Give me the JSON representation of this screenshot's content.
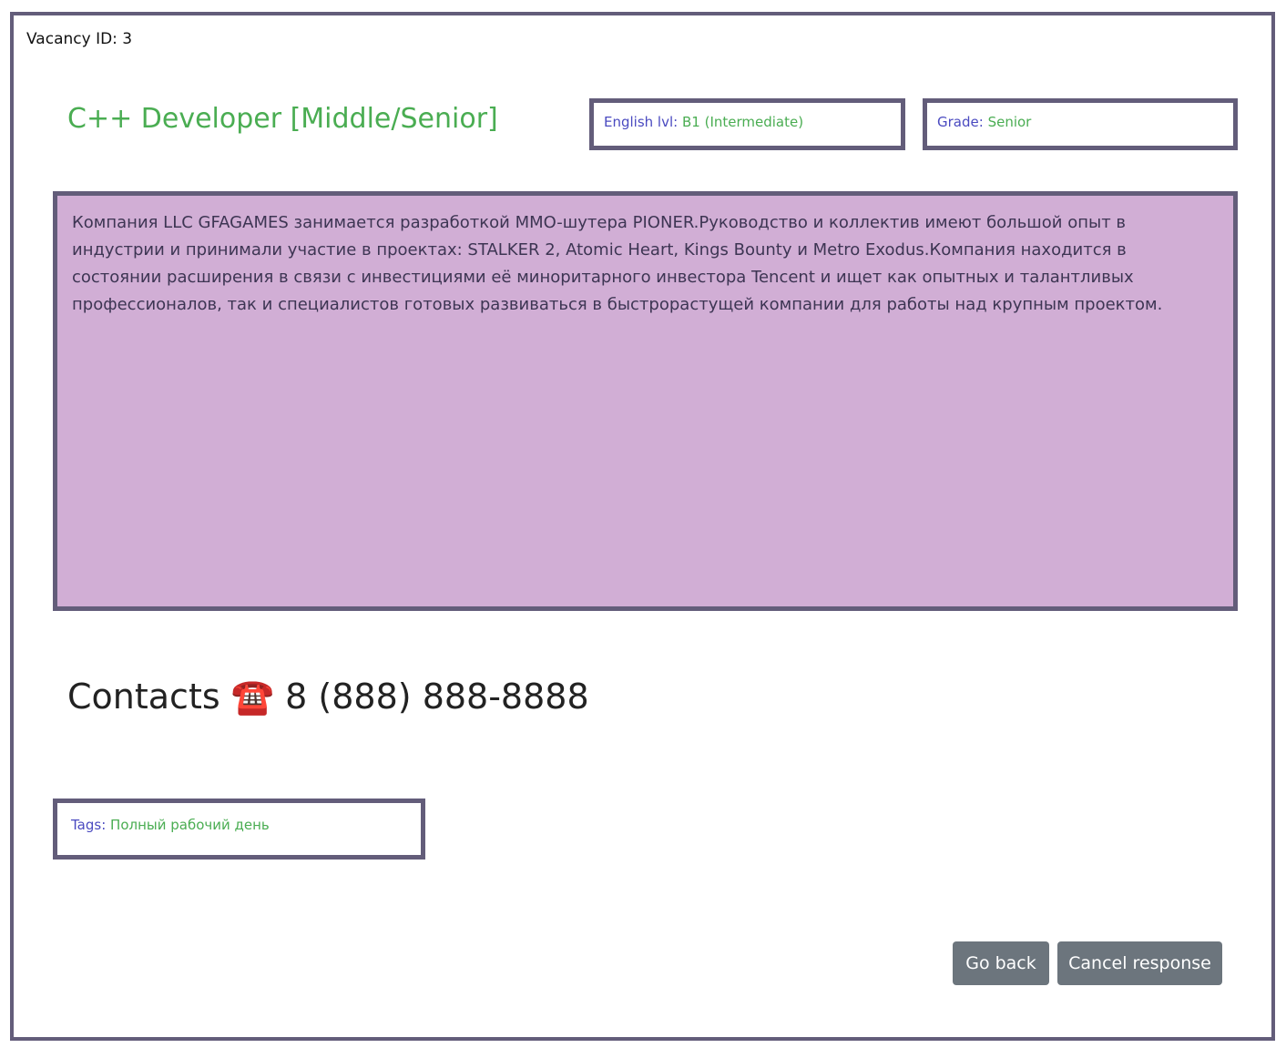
{
  "vacancy": {
    "id_label": "Vacancy ID: 3",
    "title": "C++ Developer [Middle/Senior]",
    "english": {
      "label": "English lvl:",
      "value": "B1 (Intermediate)"
    },
    "grade": {
      "label": "Grade:",
      "value": "Senior"
    },
    "description": "Компания LLC GFAGAMES занимается разработкой MMO-шутера PIONER.Руководство и коллектив имеют большой опыт в индустрии и принимали участие в проектах: STALKER 2, Atomic Heart, Kings Bounty и Metro Exodus.Компания находится в состоянии расширения в связи с инвестициями её миноритарного инвестора Tencent и ищет как опытных и талантливых профессионалов, так и специалистов готовых развиваться в быстрорастущей компании для работы над крупным проектом.",
    "contacts": {
      "label": "Contacts",
      "icon": "☎️",
      "phone": "8 (888) 888-8888"
    },
    "tags": {
      "label": "Tags:",
      "value": "Полный рабочий день"
    }
  },
  "actions": {
    "go_back": "Go back",
    "cancel_response": "Cancel response"
  },
  "colors": {
    "border": "#635d7a",
    "title": "#4aad52",
    "label": "#4a4ac0",
    "description_bg": "#d1aed5",
    "button_bg": "#6c757d"
  }
}
